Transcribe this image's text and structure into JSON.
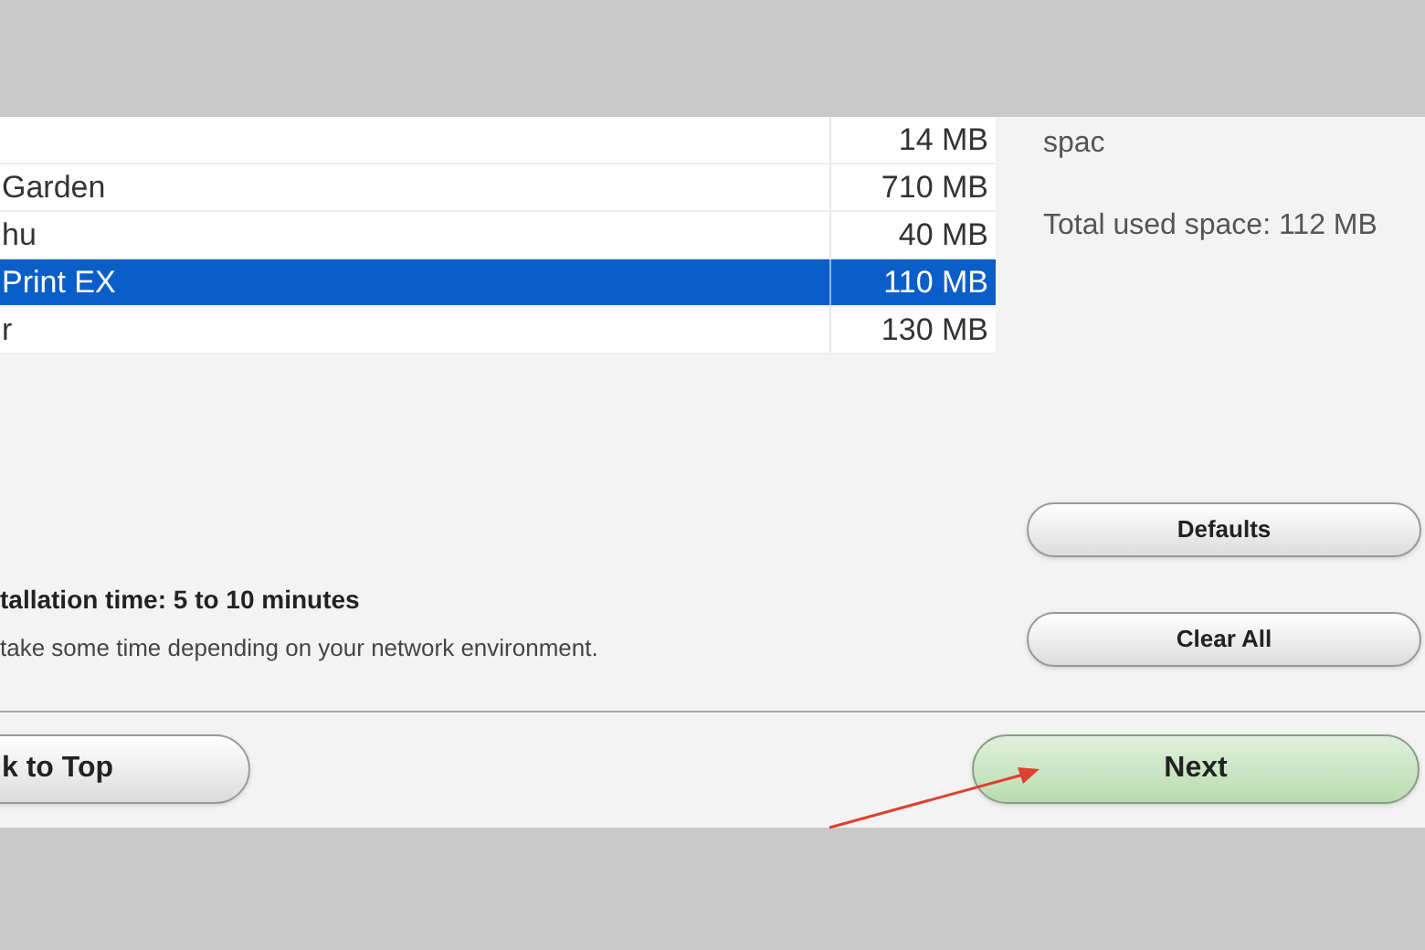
{
  "list": {
    "rows": [
      {
        "name": "",
        "size": "14 MB",
        "selected": false
      },
      {
        "name": "Garden",
        "size": "710 MB",
        "selected": false
      },
      {
        "name": "hu",
        "size": "40 MB",
        "selected": false
      },
      {
        "name": "Print EX",
        "size": "110 MB",
        "selected": true
      },
      {
        "name": "r",
        "size": "130 MB",
        "selected": false
      }
    ]
  },
  "space_info": {
    "line_1": "spac",
    "total": "Total used space: 112 MB"
  },
  "install_time": {
    "title": "tallation time: 5 to 10 minutes",
    "note": "take some time depending on your network environment."
  },
  "side_buttons": [
    "Defaults",
    "Clear All"
  ],
  "nav_buttons": {
    "back": "k to Top",
    "next": "Next"
  }
}
